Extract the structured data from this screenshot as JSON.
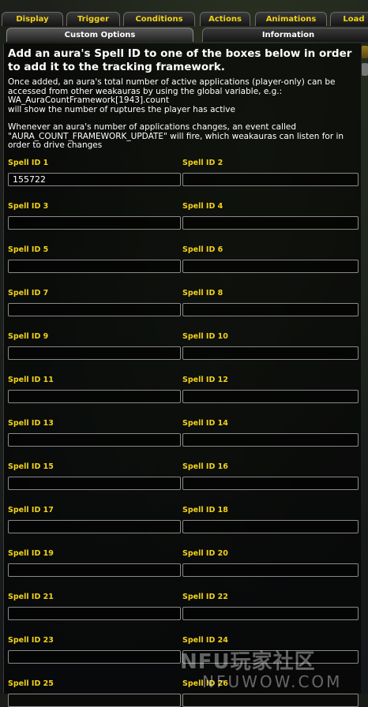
{
  "tabs_row1": [
    "Display",
    "Trigger",
    "Conditions",
    "Actions",
    "Animations",
    "Load"
  ],
  "tabs_row2": [
    "Custom Options",
    "Information"
  ],
  "active_tab_row2": "Custom Options",
  "heading": "Add an aura's Spell ID to one of the boxes below in order to add it to the tracking framework.",
  "description_1": "Once added, an aura's total number of active applications (player-only) can be accessed from other weakauras by using the global variable, e.g.:\nWA_AuraCountFramework[1943].count\nwill show the number of ruptures the player has active",
  "description_2": "Whenever an aura's number of applications changes, an event called \"AURA_COUNT_FRAMEWORK_UPDATE\" will fire, which weakauras can listen for in order to drive changes",
  "fields": [
    {
      "label": "Spell ID 1",
      "value": "155722"
    },
    {
      "label": "Spell ID 2",
      "value": ""
    },
    {
      "label": "Spell ID 3",
      "value": ""
    },
    {
      "label": "Spell ID 4",
      "value": ""
    },
    {
      "label": "Spell ID 5",
      "value": ""
    },
    {
      "label": "Spell ID 6",
      "value": ""
    },
    {
      "label": "Spell ID 7",
      "value": ""
    },
    {
      "label": "Spell ID 8",
      "value": ""
    },
    {
      "label": "Spell ID 9",
      "value": ""
    },
    {
      "label": "Spell ID 10",
      "value": ""
    },
    {
      "label": "Spell ID 11",
      "value": ""
    },
    {
      "label": "Spell ID 12",
      "value": ""
    },
    {
      "label": "Spell ID 13",
      "value": ""
    },
    {
      "label": "Spell ID 14",
      "value": ""
    },
    {
      "label": "Spell ID 15",
      "value": ""
    },
    {
      "label": "Spell ID 16",
      "value": ""
    },
    {
      "label": "Spell ID 17",
      "value": ""
    },
    {
      "label": "Spell ID 18",
      "value": ""
    },
    {
      "label": "Spell ID 19",
      "value": ""
    },
    {
      "label": "Spell ID 20",
      "value": ""
    },
    {
      "label": "Spell ID 21",
      "value": ""
    },
    {
      "label": "Spell ID 22",
      "value": ""
    },
    {
      "label": "Spell ID 23",
      "value": ""
    },
    {
      "label": "Spell ID 24",
      "value": ""
    },
    {
      "label": "Spell ID 25",
      "value": ""
    },
    {
      "label": "Spell ID 26",
      "value": ""
    }
  ],
  "watermark": {
    "line1": "NFU玩家社区",
    "line2": "NFUWOW.COM"
  }
}
